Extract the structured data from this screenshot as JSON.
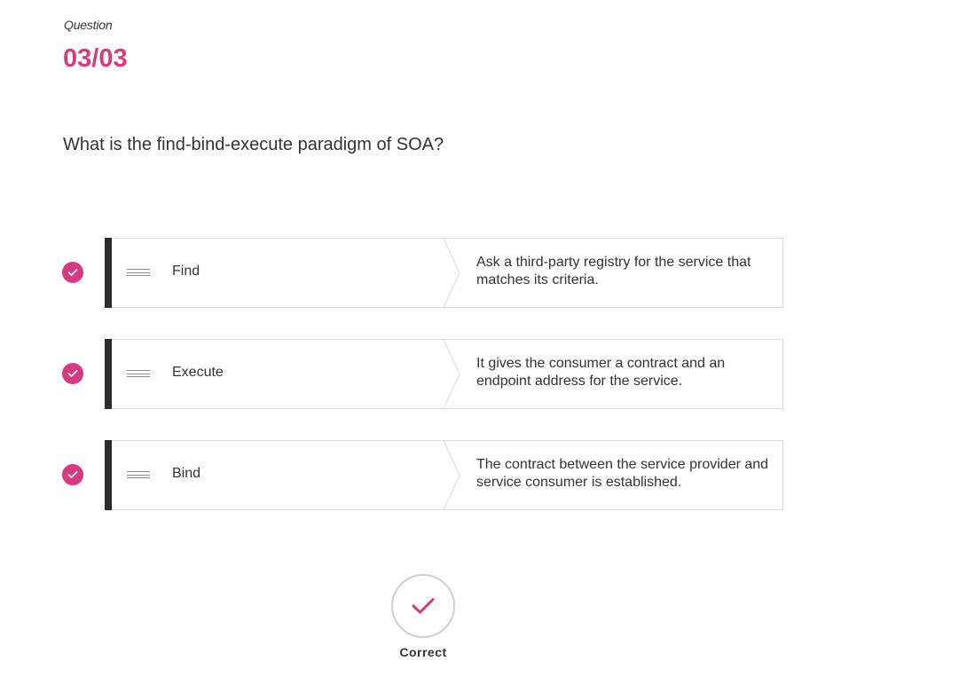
{
  "header": {
    "label": "Question",
    "number": "03/03"
  },
  "question": {
    "text": "What is the find-bind-execute paradigm of SOA?"
  },
  "matches": [
    {
      "term": "Find",
      "definition": "Ask a third-party registry for the service that matches its criteria.",
      "status": "correct"
    },
    {
      "term": "Execute",
      "definition": "It gives the consumer a contract and an endpoint address for the service.",
      "status": "correct"
    },
    {
      "term": "Bind",
      "definition": "The contract between the service provider and service consumer is established.",
      "status": "correct"
    }
  ],
  "result": {
    "label": "Correct",
    "icon": "checkmark-icon"
  },
  "colors": {
    "accent": "#d63a82",
    "card_bar": "#2b2b2b",
    "card_border": "#dcdcdc",
    "text": "#333333"
  }
}
